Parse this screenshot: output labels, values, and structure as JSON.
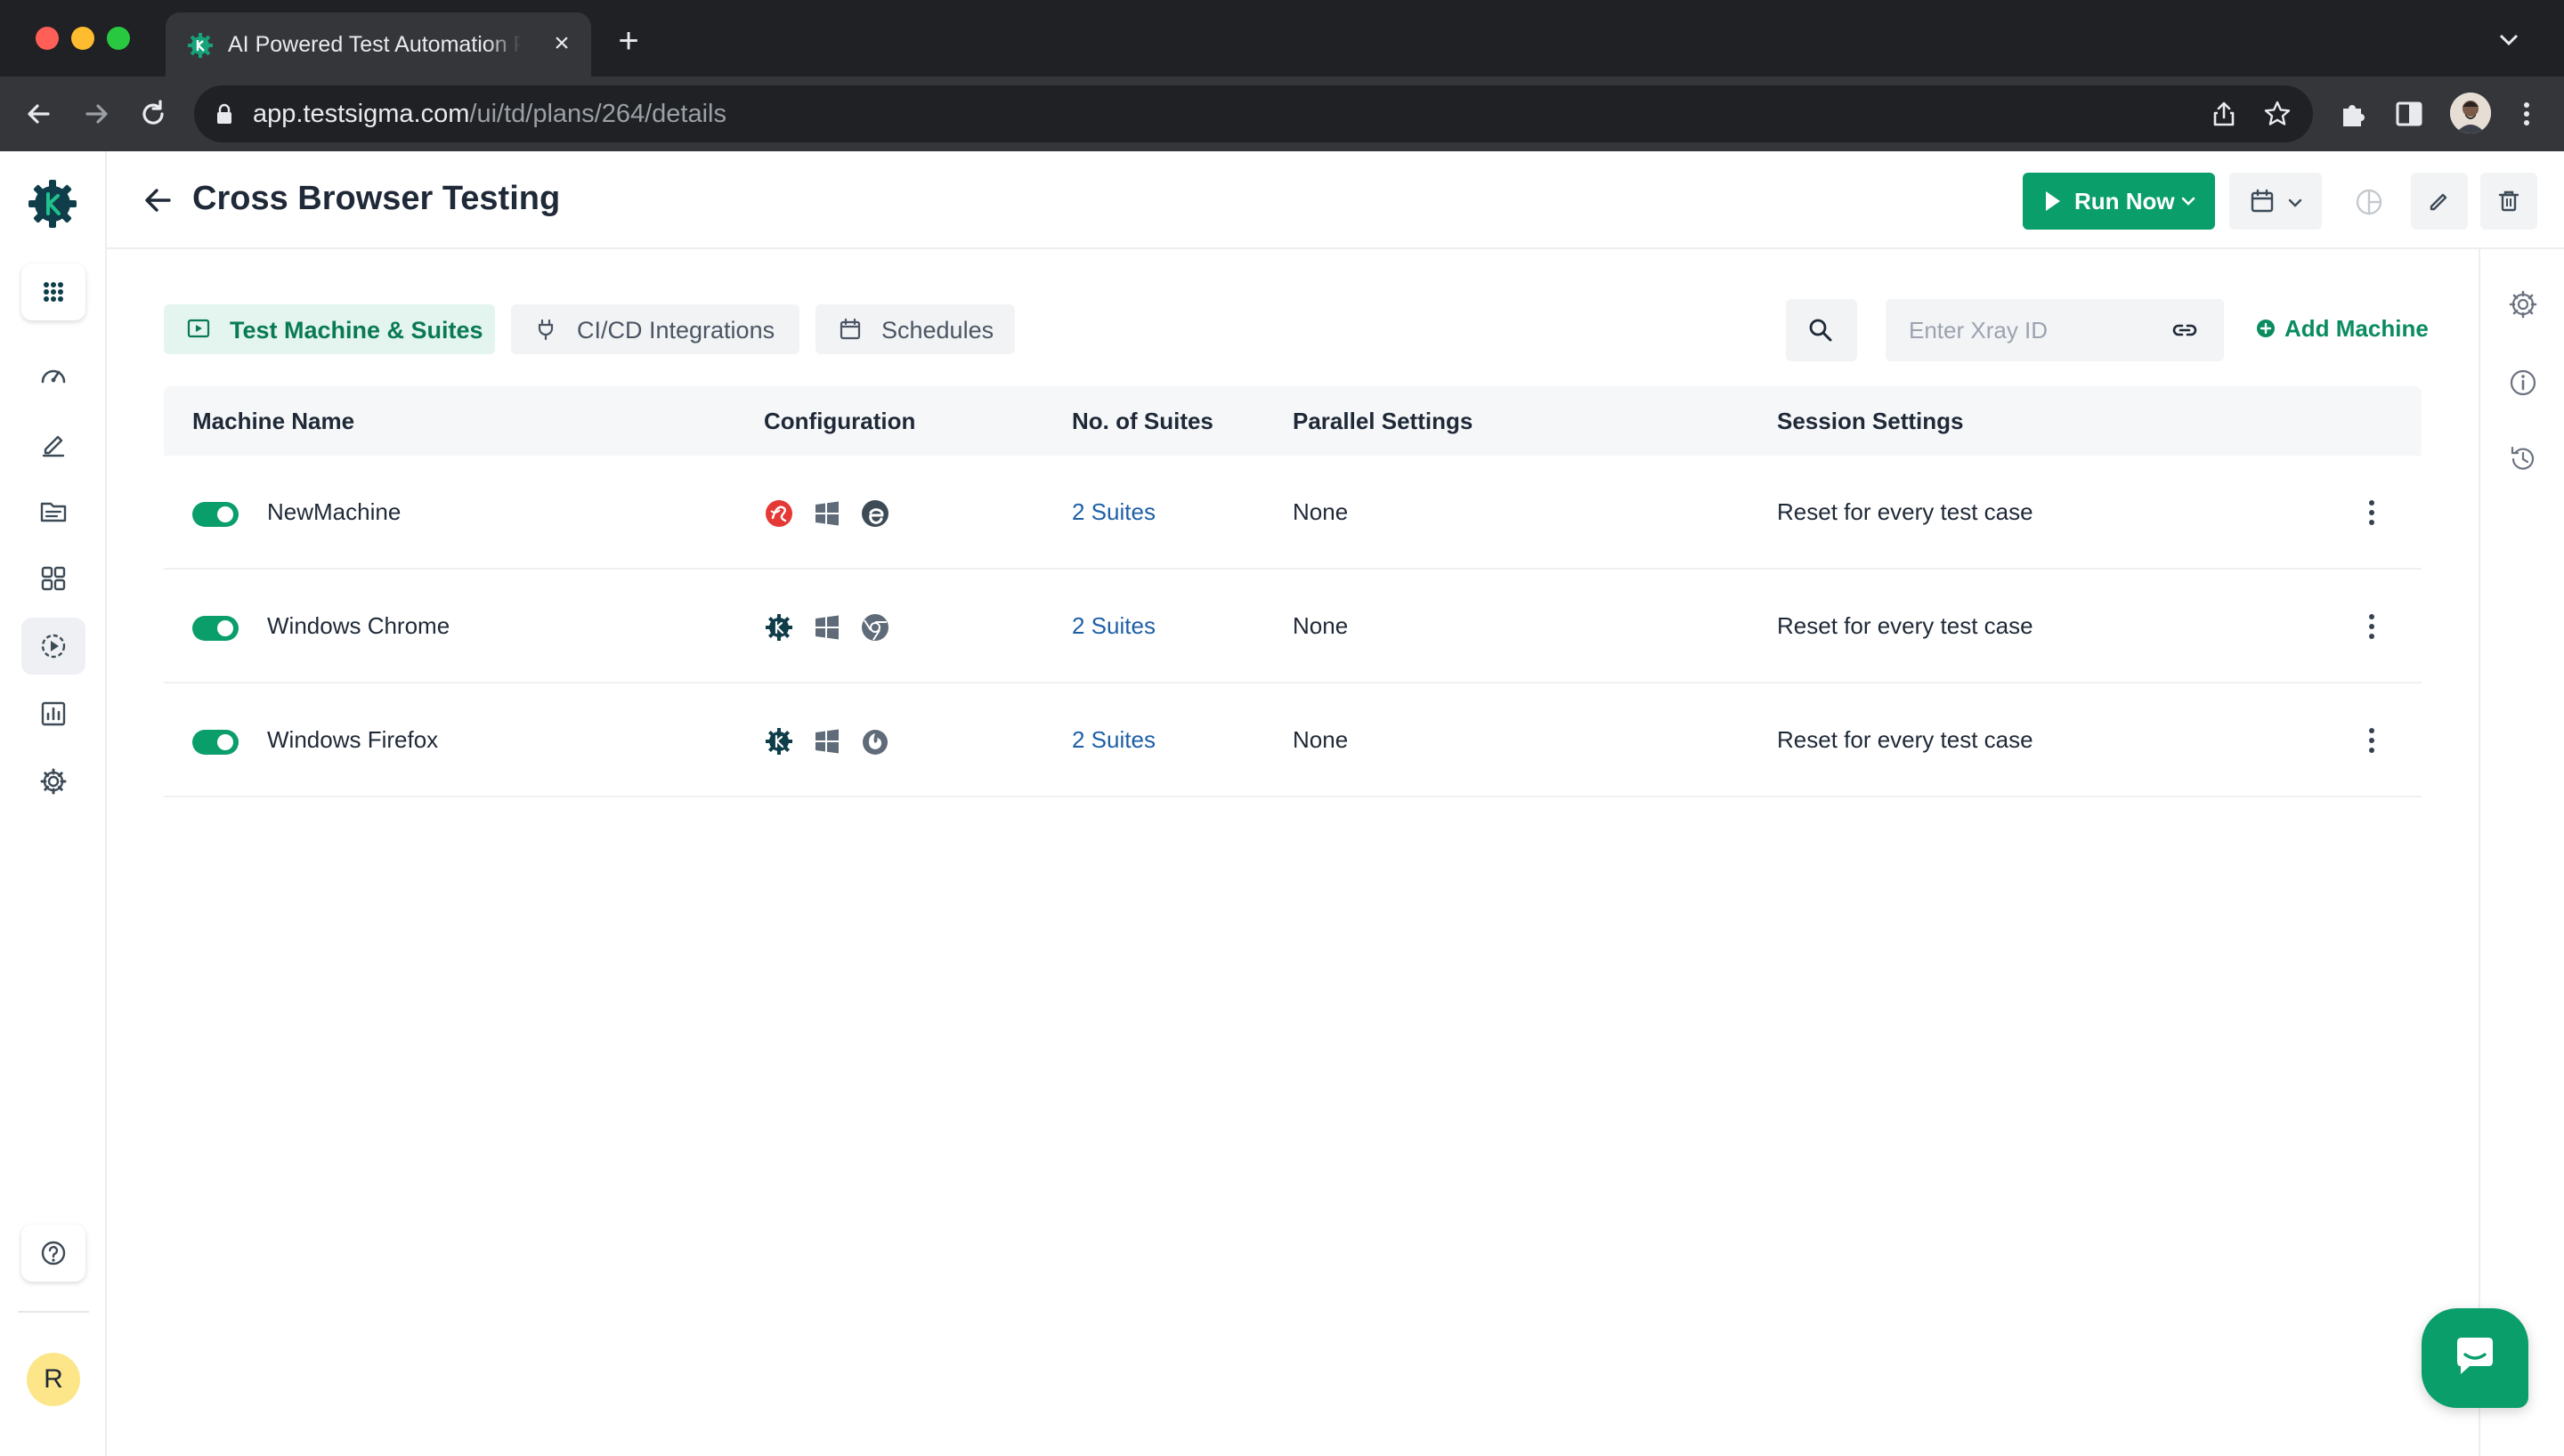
{
  "browser": {
    "tab_title": "AI Powered Test Automation Platform",
    "url_host": "app.testsigma.com",
    "url_path": "/ui/td/plans/264/details"
  },
  "header": {
    "title": "Cross Browser Testing",
    "run_now_label": "Run Now"
  },
  "tabs": [
    {
      "label": "Test Machine & Suites",
      "active": true
    },
    {
      "label": "CI/CD Integrations",
      "active": false
    },
    {
      "label": "Schedules",
      "active": false
    }
  ],
  "xray": {
    "placeholder": "Enter Xray ID"
  },
  "add_machine_label": "Add Machine",
  "table": {
    "columns": [
      "Machine Name",
      "Configuration",
      "No. of Suites",
      "Parallel Settings",
      "Session Settings"
    ],
    "rows": [
      {
        "enabled": true,
        "name": "NewMachine",
        "config_icons": [
          "lambdatest-icon",
          "windows-icon",
          "edge-icon"
        ],
        "suites": "2 Suites",
        "parallel": "None",
        "session": "Reset for every test case"
      },
      {
        "enabled": true,
        "name": "Windows Chrome",
        "config_icons": [
          "testsigma-lab-icon",
          "windows-icon",
          "chrome-icon"
        ],
        "suites": "2 Suites",
        "parallel": "None",
        "session": "Reset for every test case"
      },
      {
        "enabled": true,
        "name": "Windows Firefox",
        "config_icons": [
          "testsigma-lab-icon",
          "windows-icon",
          "firefox-icon"
        ],
        "suites": "2 Suites",
        "parallel": "None",
        "session": "Reset for every test case"
      }
    ]
  },
  "user": {
    "initial": "R"
  },
  "colors": {
    "accent": "#0a9e6b",
    "link": "#1d5fa6"
  }
}
